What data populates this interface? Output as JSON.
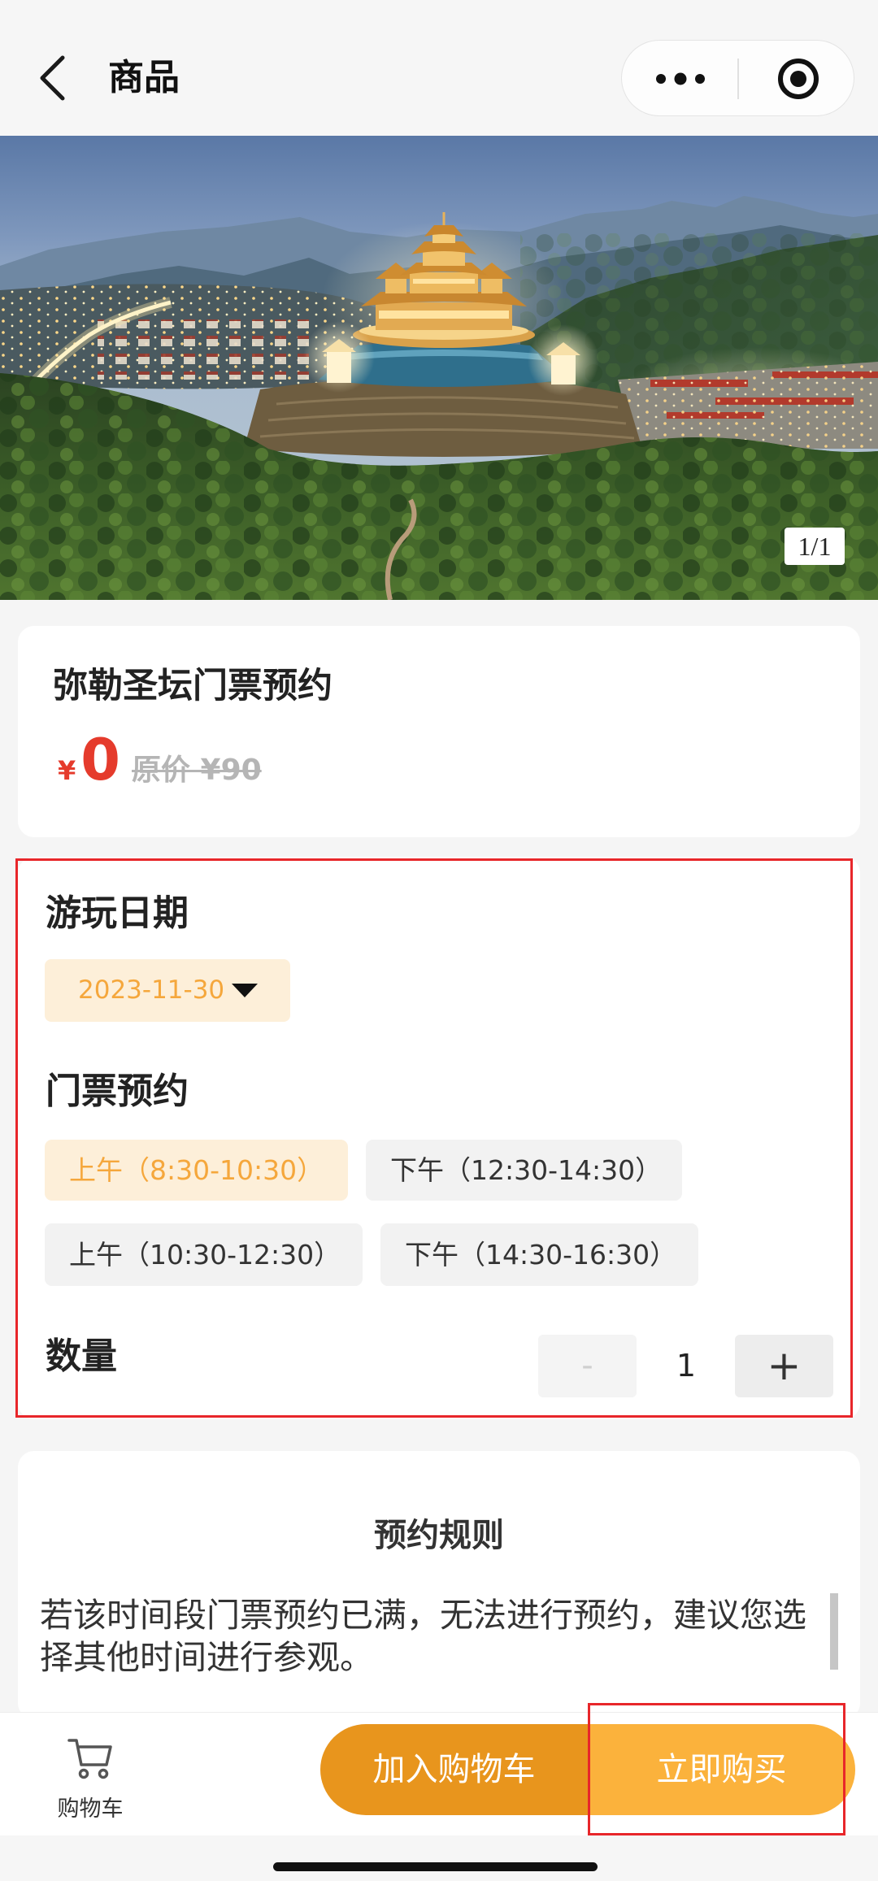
{
  "nav": {
    "title": "商品"
  },
  "icons": {
    "back": "back-chevron-icon",
    "more": "more-dots-icon",
    "exit": "circle-dot-icon",
    "dropdown": "dropdown-triangle-icon",
    "cart": "shopping-cart-icon"
  },
  "banner": {
    "page_indicator": "1/1"
  },
  "product": {
    "title": "弥勒圣坛门票预约",
    "currency": "¥",
    "price": "0",
    "original_price": "原价 ¥90"
  },
  "booking": {
    "date_label": "游玩日期",
    "selected_date": "2023-11-30",
    "ticket_label": "门票预约",
    "time_slots": [
      {
        "label": "上午（8:30-10:30）",
        "selected": true
      },
      {
        "label": "下午（12:30-14:30）",
        "selected": false
      },
      {
        "label": "上午（10:30-12:30）",
        "selected": false
      },
      {
        "label": "下午（14:30-16:30）",
        "selected": false
      }
    ],
    "quantity_label": "数量",
    "quantity": "1",
    "decrement_label": "-",
    "increment_label": "+"
  },
  "rules": {
    "title": "预约规则",
    "lines": [
      "若该时间段门票预约已满，无法进行预约，建议您选",
      "择其他时间进行参观。"
    ]
  },
  "bottom_bar": {
    "cart_label": "购物车",
    "add_to_cart_label": "加入购物车",
    "buy_now_label": "立即购买"
  },
  "colors": {
    "accent": "#f5a73c",
    "accent_bg": "#fdefd9",
    "price_red": "#e53b2c",
    "add_to_cart_bg": "#e8951d",
    "buy_now_bg": "#fbb23c",
    "annotation_red": "#e8262a"
  }
}
